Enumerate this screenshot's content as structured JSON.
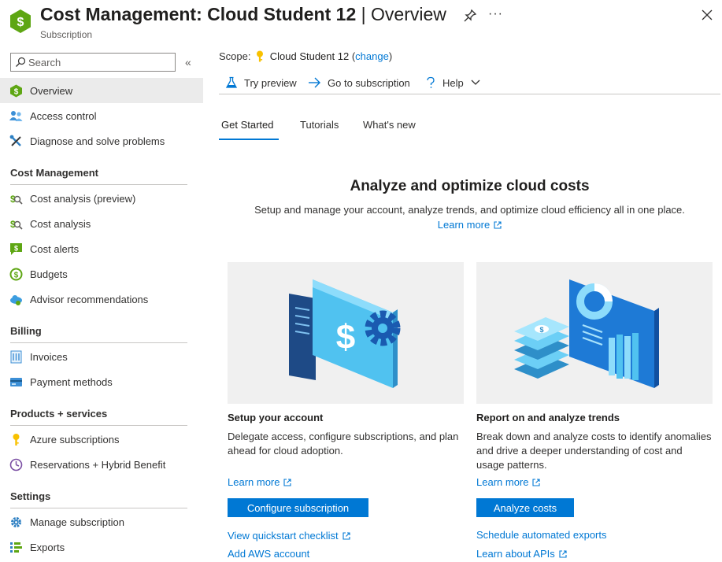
{
  "header": {
    "title_main": "Cost Management: Cloud Student 12",
    "title_sep": "|",
    "title_sub": "Overview",
    "subtitle": "Subscription",
    "more": "···"
  },
  "sidebar": {
    "search_placeholder": "Search",
    "collapse": "«",
    "top_items": [
      {
        "label": "Overview",
        "icon": "cost-management-icon"
      },
      {
        "label": "Access control",
        "icon": "people-icon"
      },
      {
        "label": "Diagnose and solve problems",
        "icon": "wrench-icon"
      }
    ],
    "sections": [
      {
        "title": "Cost Management",
        "items": [
          {
            "label": "Cost analysis (preview)",
            "icon": "cost-analysis-icon"
          },
          {
            "label": "Cost analysis",
            "icon": "cost-analysis-icon"
          },
          {
            "label": "Cost alerts",
            "icon": "cost-alert-icon"
          },
          {
            "label": "Budgets",
            "icon": "budget-icon"
          },
          {
            "label": "Advisor recommendations",
            "icon": "advisor-cloud-icon"
          }
        ]
      },
      {
        "title": "Billing",
        "items": [
          {
            "label": "Invoices",
            "icon": "invoice-icon"
          },
          {
            "label": "Payment methods",
            "icon": "credit-card-icon"
          }
        ]
      },
      {
        "title": "Products + services",
        "items": [
          {
            "label": "Azure subscriptions",
            "icon": "key-icon"
          },
          {
            "label": "Reservations + Hybrid Benefit",
            "icon": "clock-icon"
          }
        ]
      },
      {
        "title": "Settings",
        "items": [
          {
            "label": "Manage subscription",
            "icon": "gear-icon"
          },
          {
            "label": "Exports",
            "icon": "export-icon"
          }
        ]
      }
    ]
  },
  "scope": {
    "label": "Scope:",
    "name": "Cloud Student 12",
    "open": "(",
    "change": "change",
    "close": ")"
  },
  "toolbar": {
    "try_preview": "Try preview",
    "go_to_subscription": "Go to subscription",
    "help": "Help"
  },
  "tabs": [
    "Get Started",
    "Tutorials",
    "What's new"
  ],
  "hero": {
    "title": "Analyze and optimize cloud costs",
    "description": "Setup and manage your account, analyze trends, and optimize cloud efficiency all in one place.",
    "learn_more": "Learn more"
  },
  "cards": [
    {
      "title": "Setup your account",
      "description": "Delegate access, configure subscriptions, and plan ahead for cloud adoption.",
      "learn_more": "Learn more",
      "button": "Configure subscription",
      "links": [
        "View quickstart checklist",
        "Add AWS account"
      ]
    },
    {
      "title": "Report on and analyze trends",
      "description": "Break down and analyze costs to identify anomalies and drive a deeper understanding of cost and usage patterns.",
      "learn_more": "Learn more",
      "button": "Analyze costs",
      "links": [
        "Schedule automated exports",
        "Learn about APIs"
      ]
    }
  ],
  "colors": {
    "accent": "#0078d4",
    "cost_green": "#5ea613",
    "active_bg": "#ebebeb"
  }
}
